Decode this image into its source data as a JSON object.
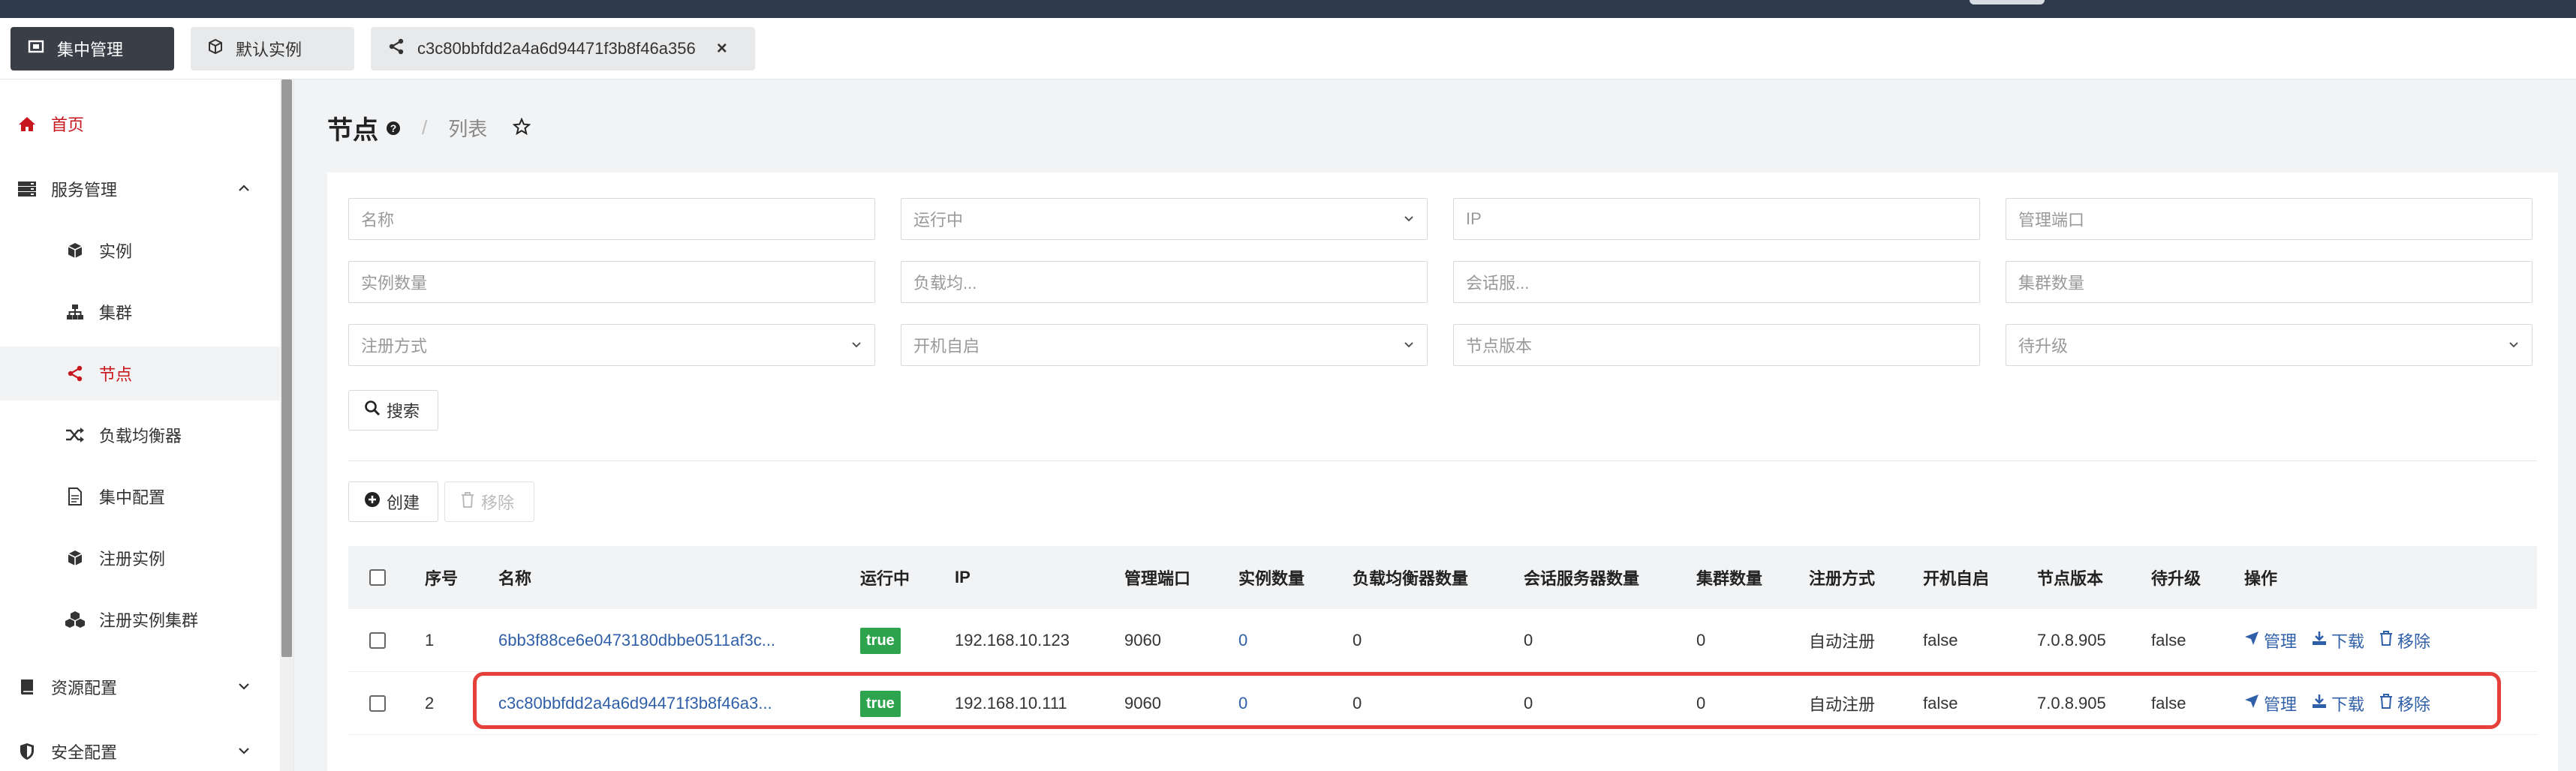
{
  "colors": {
    "accent_red": "#c8161d",
    "link_blue": "#2f5fa8",
    "success_green": "#2ea44f",
    "highlight_red": "#e5403a",
    "dark_tab": "#3a3f47"
  },
  "tabs": [
    {
      "label": "集中管理",
      "icon": "layers-icon"
    },
    {
      "label": "默认实例",
      "icon": "cube-icon"
    },
    {
      "label": "c3c80bbfdd2a4a6d94471f3b8f46a356",
      "icon": "share-icon",
      "close_label": "×"
    }
  ],
  "sidebar": {
    "items": [
      {
        "label": "首页",
        "icon": "home-icon"
      },
      {
        "label": "服务管理",
        "icon": "server-icon"
      },
      {
        "label": "实例",
        "icon": "cube-icon"
      },
      {
        "label": "集群",
        "icon": "sitemap-icon"
      },
      {
        "label": "节点",
        "icon": "share-icon"
      },
      {
        "label": "负载均衡器",
        "icon": "random-icon"
      },
      {
        "label": "集中配置",
        "icon": "file-icon"
      },
      {
        "label": "注册实例",
        "icon": "cube-icon"
      },
      {
        "label": "注册实例集群",
        "icon": "cubes-icon"
      },
      {
        "label": "资源配置",
        "icon": "book-icon"
      },
      {
        "label": "安全配置",
        "icon": "shield-icon"
      }
    ]
  },
  "page": {
    "title": "节点",
    "breadcrumb": "列表"
  },
  "filters": {
    "name": "名称",
    "running": "运行中",
    "ip": "IP",
    "mgmt_port": "管理端口",
    "instance_count": "实例数量",
    "lb": "负载均...",
    "session": "会话服...",
    "cluster_count": "集群数量",
    "register_mode": "注册方式",
    "autostart": "开机自启",
    "node_version": "节点版本",
    "upgrade": "待升级"
  },
  "buttons": {
    "search": "搜索",
    "create": "创建",
    "remove": "移除"
  },
  "table": {
    "columns": [
      "序号",
      "名称",
      "运行中",
      "IP",
      "管理端口",
      "实例数量",
      "负载均衡器数量",
      "会话服务器数量",
      "集群数量",
      "注册方式",
      "开机自启",
      "节点版本",
      "待升级",
      "操作"
    ],
    "actions": {
      "manage": "管理",
      "download": "下载",
      "remove": "移除"
    },
    "rows": [
      {
        "seq": "1",
        "name": "6bb3f88ce6e0473180dbbe0511af3c...",
        "running": "true",
        "ip": "192.168.10.123",
        "port": "9060",
        "instances": "0",
        "lb": "0",
        "session": "0",
        "clusters": "0",
        "register": "自动注册",
        "autostart": "false",
        "version": "7.0.8.905",
        "upgrade": "false"
      },
      {
        "seq": "2",
        "name": "c3c80bbfdd2a4a6d94471f3b8f46a3...",
        "running": "true",
        "ip": "192.168.10.111",
        "port": "9060",
        "instances": "0",
        "lb": "0",
        "session": "0",
        "clusters": "0",
        "register": "自动注册",
        "autostart": "false",
        "version": "7.0.8.905",
        "upgrade": "false"
      }
    ]
  }
}
